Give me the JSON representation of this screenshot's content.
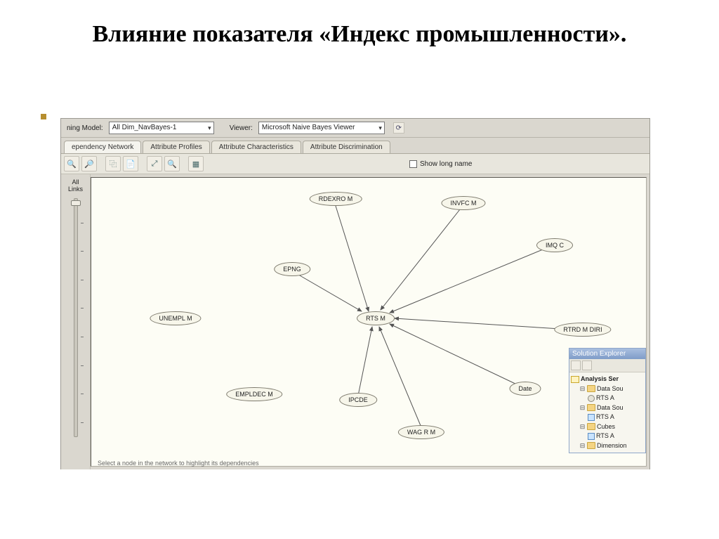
{
  "slide": {
    "title": "Влияние показателя «Индекс промышленности»."
  },
  "topbar": {
    "model_label_suffix": "ning Model:",
    "model_value": "All Dim_NavBayes-1",
    "viewer_label": "Viewer:",
    "viewer_value": "Microsoft Naive Bayes Viewer"
  },
  "tabs": {
    "t0": "ependency Network",
    "t1": "Attribute Profiles",
    "t2": "Attribute Characteristics",
    "t3": "Attribute Discrimination"
  },
  "toolbar": {
    "show_long_name": "Show long name"
  },
  "slider": {
    "label": "All Links"
  },
  "nodes": {
    "rdexro": "RDEXRO M",
    "invfc": "INVFC M",
    "imqc": "IMQ C",
    "epng": "EPNG",
    "unempl": "UNEMPL M",
    "rts": "RTS M",
    "rtrd": "RTRD M DIRI",
    "empldec": "EMPLDEC M",
    "ipcde": "IPCDE",
    "date": "Date",
    "wagr": "WAG R M"
  },
  "status": "Select a node in the network to highlight its dependencies",
  "explorer": {
    "title": "Solution Explorer",
    "project": "Analysis Ser",
    "datasources": "Data Sou",
    "ds_item": "RTS A",
    "dsv": "Data Sou",
    "dsv_item": "RTS A",
    "cubes": "Cubes",
    "cube_item": "RTS A",
    "dimensions": "Dimension"
  }
}
